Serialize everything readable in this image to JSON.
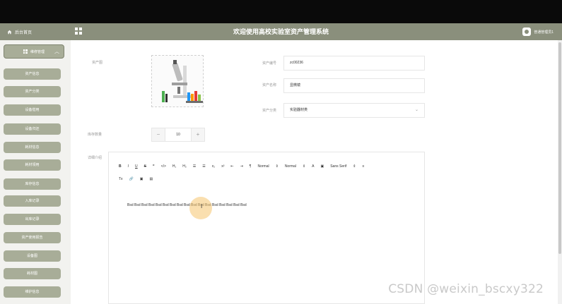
{
  "header": {
    "home_label": "后台首页",
    "system_title": "欢迎使用高校实验室资产管理系统",
    "user_label": "普通管理员1"
  },
  "sidebar": {
    "section_label": "维修管理",
    "items": [
      {
        "label": "资产信息"
      },
      {
        "label": "资产分类"
      },
      {
        "label": "设备借用"
      },
      {
        "label": "设备归还"
      },
      {
        "label": "耗材信息"
      },
      {
        "label": "耗材领用"
      },
      {
        "label": "库存信息"
      },
      {
        "label": "入库记录"
      },
      {
        "label": "出库记录"
      },
      {
        "label": "资产使用报告"
      },
      {
        "label": "设备图"
      },
      {
        "label": "耗材图"
      },
      {
        "label": "维护信息"
      }
    ]
  },
  "form": {
    "photo_label": "资产图",
    "code_label": "资产编号",
    "code_value": "zc00236",
    "name_label": "资产名称",
    "name_value": "显微镜",
    "category_label": "资产分类",
    "category_value": "实验器材类",
    "stock_label": "库存数量",
    "stock_value": "10",
    "stock_minus": "−",
    "stock_plus": "+",
    "detail_label": "详细介绍"
  },
  "editor": {
    "toolbar_row1": [
      "B",
      "I",
      "U",
      "S",
      "❞",
      "</>",
      "H₁",
      "H₂",
      "☰",
      "☰",
      "x₂",
      "x²",
      "⇤",
      "⇥",
      "¶",
      "Normal",
      "⇕",
      "Normal",
      "⇕",
      "A",
      "▣",
      "Sans Serif",
      "⇕",
      "≡"
    ],
    "toolbar_row2": [
      "Tx",
      "🔗",
      "▣",
      "▤"
    ],
    "content": "Bsd  Bsd Bsd Bsd Bsd Bsd Bsd Bsd Bsd Bsd Bsd Bsd Bsd Bsd Bsd Bsd Bsd"
  },
  "watermark": "CSDN @weixin_bscxy322",
  "colors": {
    "topbar": "#0a0a0a",
    "header": "#8a8f7c",
    "sidebar_button": "#a8ad98",
    "cursor_highlight": "#f6c46e"
  }
}
